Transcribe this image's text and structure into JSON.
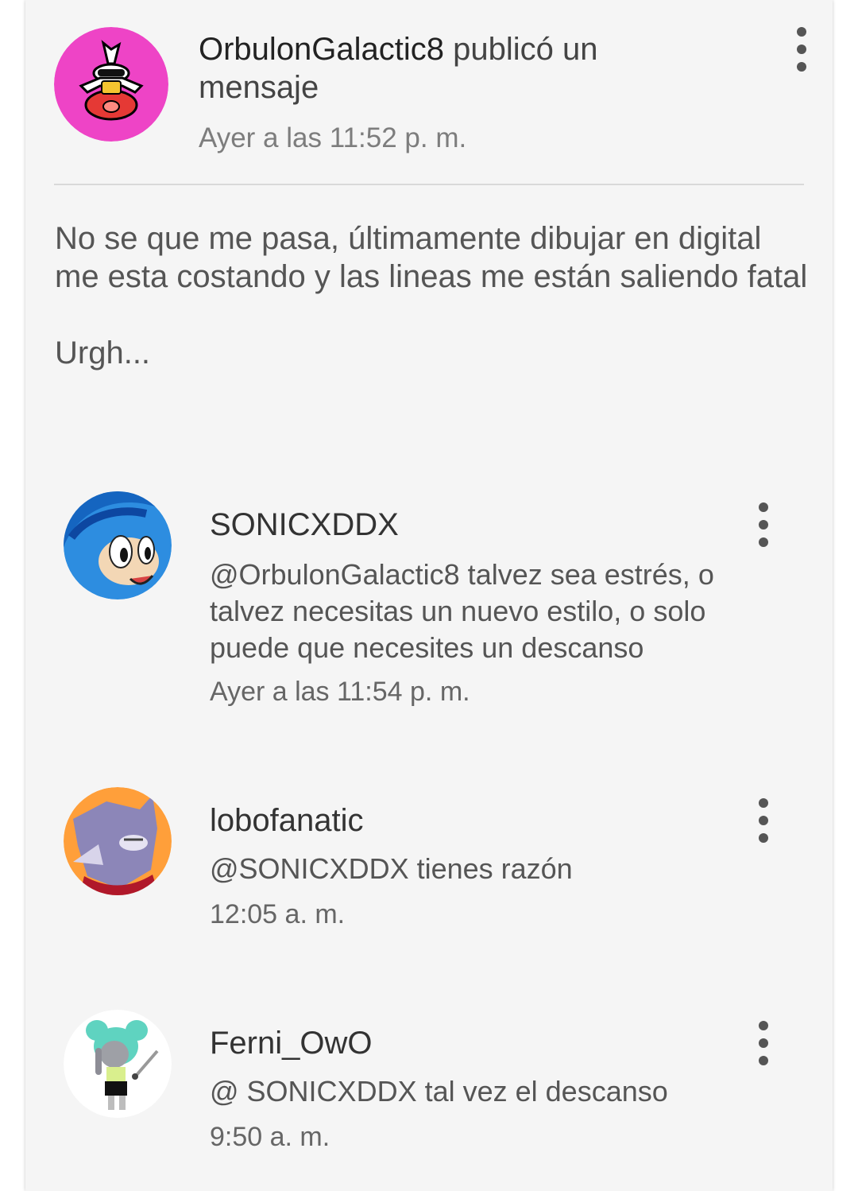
{
  "post": {
    "author": "OrbulonGalactic8",
    "action_text": "publicó un mensaje",
    "time": "Ayer a las 11:52 p. m.",
    "avatar_icon": "avatar-orbulon",
    "body_lines": [
      "No se que me pasa, últimamente dibujar en digital me esta costando y las lineas me están saliendo fatal",
      "Urgh..."
    ],
    "menu_icon": "more-vert-icon"
  },
  "comments": [
    {
      "user": "SONICXDDX",
      "text": "@OrbulonGalactic8  talvez sea estrés, o talvez necesitas un nuevo estilo, o solo puede que necesites un descanso",
      "time": "Ayer a las 11:54 p. m.",
      "avatar_icon": "avatar-sonic"
    },
    {
      "user": "lobofanatic",
      "text": "@SONICXDDX tienes razón",
      "time": "12:05 a. m.",
      "avatar_icon": "avatar-wolf"
    },
    {
      "user": "Ferni_OwO",
      "text": "@ SONICXDDX  tal vez el descanso",
      "time": "9:50 a. m.",
      "avatar_icon": "avatar-bunny-girl"
    }
  ],
  "colors": {
    "card_background": "#f5f5f5",
    "divider": "#d9d9d9",
    "orbulon_avatar": "#ee44c6",
    "sonic_avatar": "#1a73c7",
    "wolf_avatar": "#ff9f3a"
  }
}
